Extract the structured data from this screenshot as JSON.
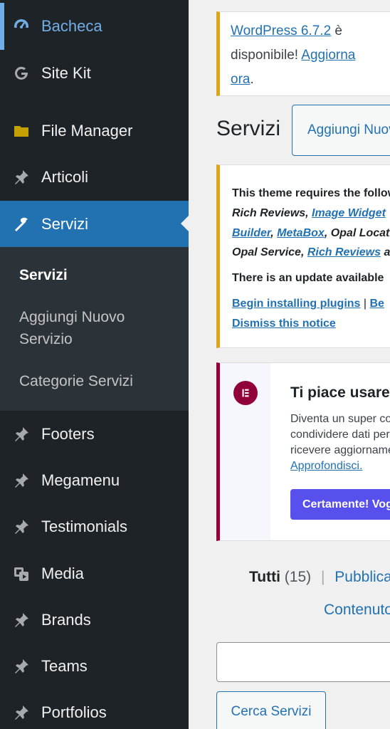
{
  "sidebar": {
    "items": [
      {
        "label": "Bacheca",
        "icon": "dashboard-icon"
      },
      {
        "label": "Site Kit",
        "icon": "google-g-icon"
      },
      {
        "label": "File Manager",
        "icon": "folder-icon"
      },
      {
        "label": "Articoli",
        "icon": "pin-icon"
      },
      {
        "label": "Servizi",
        "icon": "hammer-icon"
      },
      {
        "label": "Footers",
        "icon": "pin-icon"
      },
      {
        "label": "Megamenu",
        "icon": "pin-icon"
      },
      {
        "label": "Testimonials",
        "icon": "pin-icon"
      },
      {
        "label": "Media",
        "icon": "media-icon"
      },
      {
        "label": "Brands",
        "icon": "pin-icon"
      },
      {
        "label": "Teams",
        "icon": "pin-icon"
      },
      {
        "label": "Portfolios",
        "icon": "pin-icon"
      }
    ],
    "submenu": [
      {
        "label": "Servizi"
      },
      {
        "label": "Aggiungi Nuovo Servizio"
      },
      {
        "label": "Categorie Servizi"
      }
    ]
  },
  "update_notice": {
    "link1": "WordPress 6.7.2",
    "text1": " è",
    "text2": "disponibile! ",
    "link2a": "Aggiorna",
    "link2b": "ora",
    "text3": "."
  },
  "header": {
    "title": "Servizi",
    "add_new": "Aggiungi Nuovo Servizio"
  },
  "plugins_notice": {
    "line1": "This theme requires the following plugins:",
    "l2_a": "Rich Reviews",
    "l2_b": ", ",
    "l2_c": "Image Widget",
    "l3_a": "Builder",
    "l3_b": ", ",
    "l3_c": "MetaBox",
    "l3_d": ", Opal Locations",
    "l4_a": "Opal Service, ",
    "l4_b": "Rich Reviews",
    "l4_c": " and",
    "line5": "There is an update available",
    "link_begin": "Begin installing plugins",
    "sep": " | ",
    "link_be": "Be",
    "link_dismiss": "Dismiss this notice"
  },
  "elementor_notice": {
    "title": "Ti piace usare Elementor?",
    "line1": "Diventa un super contributore",
    "line2": "condividere dati per",
    "line3": "ricevere aggiornamenti",
    "link": "Approfondisci.",
    "button": "Certamente! Voglio contribuire"
  },
  "filters": {
    "all_label": "Tutti",
    "all_count": "(15)",
    "separator": "|",
    "published": "Pubblicati",
    "content": "Contenuto"
  },
  "search": {
    "input_value": "",
    "button": "Cerca Servizi"
  }
}
